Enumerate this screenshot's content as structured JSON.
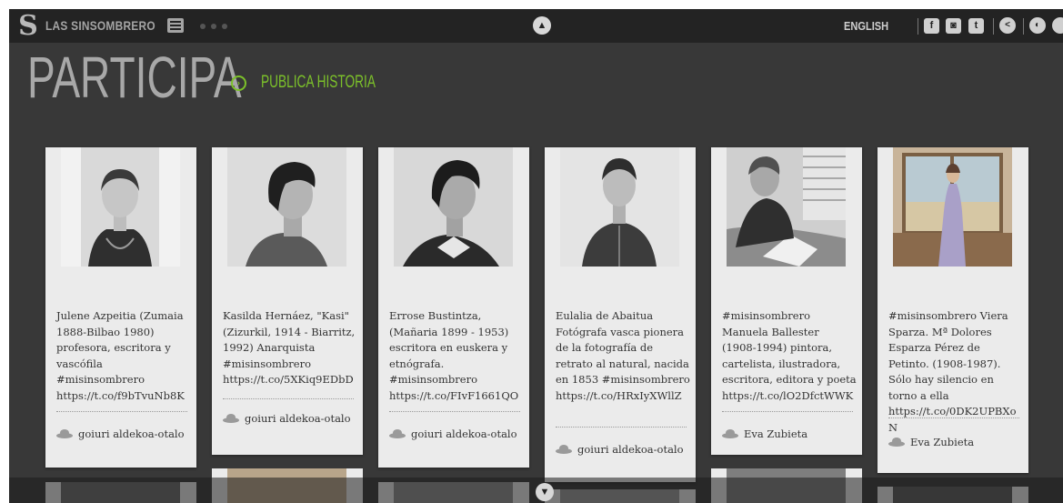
{
  "header": {
    "logo_letter": "S",
    "site_name": "LAS SINSOMBRERO",
    "language": "ENGLISH",
    "social_icons": [
      "facebook-icon",
      "instagram-icon",
      "twitter-icon",
      "share-icon",
      "sound-icon"
    ]
  },
  "page": {
    "title": "PARTICIPA",
    "publish_label": "PUBLICA HISTORIA"
  },
  "colors": {
    "accent": "#7cc12a",
    "background": "#383838",
    "topbar": "#232323",
    "card": "#ebebeb"
  },
  "cards": [
    {
      "caption": "Julene Azpeitia (Zumaia 1888-Bilbao 1980) profesora, escritora y vascófila #misinsombrero https://t.co/f9bTvuNb8K",
      "author": "goiuri aldekoa-otalo"
    },
    {
      "caption": "Kasilda Hernáez, \"Kasi\" (Zizurkil, 1914 - Biarritz, 1992) Anarquista #misinsombrero https://t.co/5XKiq9EDbD",
      "author": "goiuri aldekoa-otalo"
    },
    {
      "caption": "Errose Bustintza, (Mañaria 1899 - 1953) escritora en euskera y etnógrafa. #misinsombrero https://t.co/FIvF1661QO",
      "author": "goiuri aldekoa-otalo"
    },
    {
      "caption": "Eulalia de Abaitua Fotógrafa vasca pionera de la fotografía de retrato al natural, nacida en 1853 #misinsombrero https://t.co/HRxIyXWllZ",
      "author": "goiuri aldekoa-otalo"
    },
    {
      "caption": "#misinsombrero Manuela Ballester (1908-1994) pintora, cartelista, ilustradora, escritora, editora y poeta https://t.co/lO2DfctWWK",
      "author": "Eva Zubieta"
    },
    {
      "caption": "#misinsombrero Viera Sparza. Mª Dolores Esparza Pérez de Petinto. (1908-1987). Sólo hay silencio en torno a ella https://t.co/0DK2UPBXoN",
      "author": "Eva Zubieta"
    }
  ]
}
